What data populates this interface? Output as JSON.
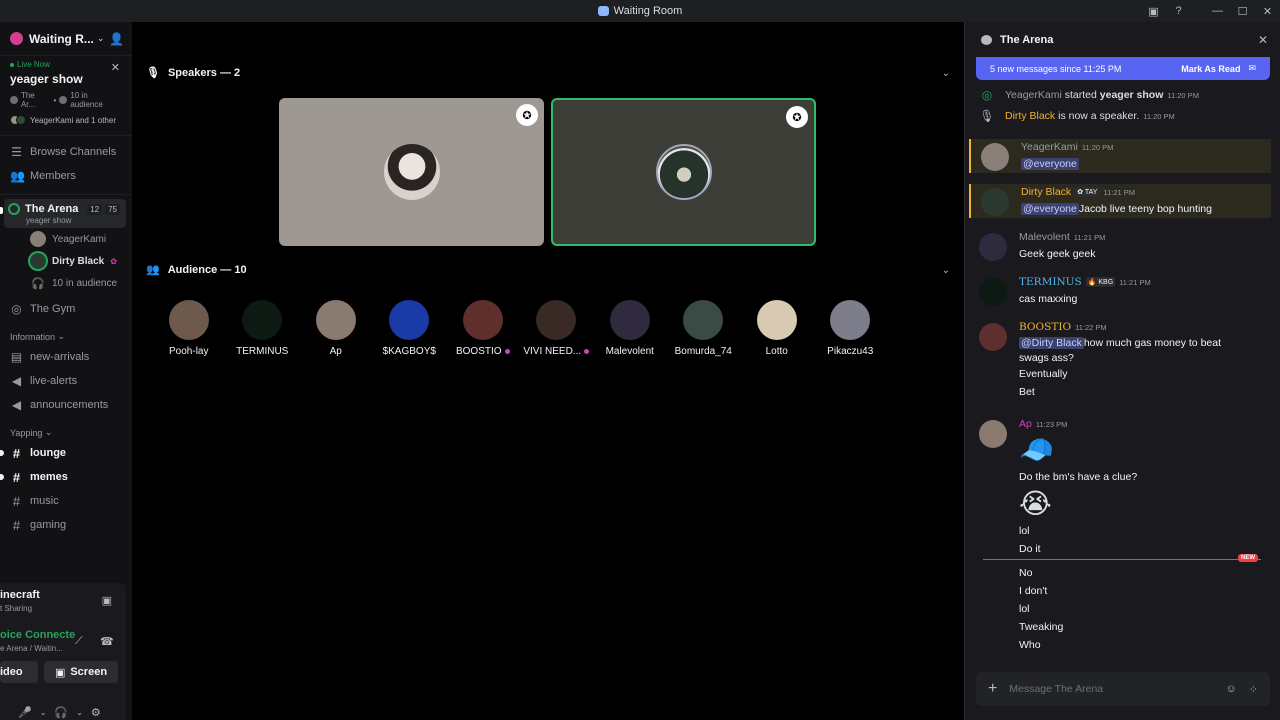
{
  "window": {
    "title": "Waiting Room"
  },
  "sidebar": {
    "server_name": "Waiting R...",
    "live": {
      "status": "Live Now",
      "title": "yeager show",
      "channel": "The Ar...",
      "audience": "10 in audience",
      "users": "YeagerKami and 1 other"
    },
    "nav": [
      {
        "label": "Browse Channels",
        "icon": "browse-icon"
      },
      {
        "label": "Members",
        "icon": "members-icon"
      }
    ],
    "voice_channel": {
      "name": "The Arena",
      "count_a": "12",
      "count_b": "75",
      "sub": "yeager show",
      "users": [
        {
          "name": "YeagerKami"
        },
        {
          "name": "Dirty Black"
        }
      ],
      "audience": "10 in audience"
    },
    "other_stage": "The Gym",
    "categories": [
      {
        "name": "Information",
        "channels": [
          {
            "name": "new-arrivals",
            "icon": "arrivals-icon"
          },
          {
            "name": "live-alerts",
            "icon": "megaphone-icon"
          },
          {
            "name": "announcements",
            "icon": "megaphone-icon"
          }
        ]
      },
      {
        "name": "Yapping",
        "channels": [
          {
            "name": "lounge",
            "unread": true
          },
          {
            "name": "memes",
            "unread": true
          },
          {
            "name": "music",
            "unread": false
          },
          {
            "name": "gaming",
            "unread": false
          }
        ]
      }
    ],
    "activity": {
      "game": "inecraft",
      "game_sub": "t Sharing",
      "voice_status": "oice Connecte",
      "voice_sub": "e Arena / Waitin...",
      "video": "ideo",
      "screen": "Screen"
    }
  },
  "stage": {
    "speakers_header": "Speakers — 2",
    "audience_header": "Audience — 10",
    "audience": [
      {
        "name": "Pooh-lay",
        "color": "#6e5a4c"
      },
      {
        "name": "TERMINUS",
        "color": "#0d1a13"
      },
      {
        "name": "Ap",
        "color": "#8b7a70"
      },
      {
        "name": "$KAGBOY$",
        "color": "#1a3aa8"
      },
      {
        "name": "BOOSTIO",
        "color": "#5e2f2c",
        "boost": true
      },
      {
        "name": "VIVI NEED...",
        "color": "#3a2a26",
        "boost": true
      },
      {
        "name": "Malevolent",
        "color": "#2f2a3e"
      },
      {
        "name": "Bomurda_74",
        "color": "#3a4a45"
      },
      {
        "name": "Lotto",
        "color": "#d8c9b2"
      },
      {
        "name": "Pikaczu43",
        "color": "#7d7d8c"
      }
    ]
  },
  "chat": {
    "title": "The Arena",
    "new_messages": "5 new messages since 11:25 PM",
    "mark_read": "Mark As Read",
    "system": [
      {
        "user": "YeagerKami",
        "text_a": " started ",
        "bold": "yeager show",
        "time": "11:20 PM"
      },
      {
        "user": "Dirty Black",
        "text_a": " is now a speaker.",
        "time": "11:20 PM"
      }
    ],
    "messages": [
      {
        "user": "YeagerKami",
        "time": "11:20 PM",
        "mention": "@everyone",
        "text": ""
      },
      {
        "user": "Dirty Black",
        "tag": "TAY",
        "time": "11:21 PM",
        "mention": "@everyone",
        "text": " Jacob live teeny bop hunting"
      },
      {
        "user": "Malevolent",
        "time": "11:21 PM",
        "text": "Geek geek geek"
      },
      {
        "user": "TERMINUS",
        "tag": "KBG",
        "time": "11:21 PM",
        "text": "cas maxxing"
      },
      {
        "user": "BOOSTIO",
        "time": "11:22 PM",
        "mention": "@Dirty Black",
        "text": " how much gas money to beat",
        "text2": "swags ass?",
        "more": [
          "Eventually",
          "Bet"
        ]
      },
      {
        "user": "Ap",
        "time": "11:23 PM",
        "text": "Do the bm's have a clue?",
        "after": [
          "lol",
          "Do it"
        ],
        "after_new": [
          "No",
          "I don't",
          "lol",
          "Tweaking",
          "Who"
        ]
      }
    ],
    "new_label": "NEW",
    "composer_placeholder": "Message The Arena"
  }
}
